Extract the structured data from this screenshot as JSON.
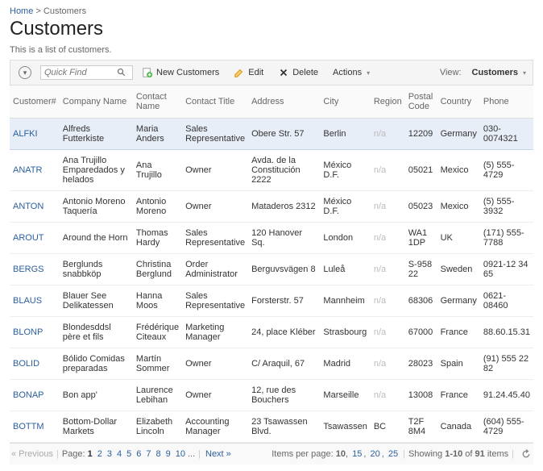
{
  "breadcrumb": {
    "home": "Home",
    "sep": ">",
    "current": "Customers"
  },
  "page_title": "Customers",
  "subtitle": "This is a list of customers.",
  "toolbar": {
    "quickfind_placeholder": "Quick Find",
    "new_label": "New Customers",
    "edit_label": "Edit",
    "delete_label": "Delete",
    "actions_label": "Actions",
    "view_label": "View:",
    "view_value": "Customers"
  },
  "columns": {
    "id": "Customer#",
    "company": "Company Name",
    "contact_name": "Contact Name",
    "contact_title": "Contact Title",
    "address": "Address",
    "city": "City",
    "region": "Region",
    "postal": "Postal Code",
    "country": "Country",
    "phone": "Phone"
  },
  "rows": [
    {
      "id": "ALFKI",
      "company": "Alfreds Futterkiste",
      "contact_name": "Maria Anders",
      "contact_title": "Sales Representative",
      "address": "Obere Str. 57",
      "city": "Berlin",
      "region": "n/a",
      "postal": "12209",
      "country": "Germany",
      "phone": "030-0074321",
      "selected": true
    },
    {
      "id": "ANATR",
      "company": "Ana Trujillo Emparedados y helados",
      "contact_name": "Ana Trujillo",
      "contact_title": "Owner",
      "address": "Avda. de la Constitución 2222",
      "city": "México D.F.",
      "region": "n/a",
      "postal": "05021",
      "country": "Mexico",
      "phone": "(5) 555-4729"
    },
    {
      "id": "ANTON",
      "company": "Antonio Moreno Taquería",
      "contact_name": "Antonio Moreno",
      "contact_title": "Owner",
      "address": "Mataderos 2312",
      "city": "México D.F.",
      "region": "n/a",
      "postal": "05023",
      "country": "Mexico",
      "phone": "(5) 555-3932"
    },
    {
      "id": "AROUT",
      "company": "Around the Horn",
      "contact_name": "Thomas Hardy",
      "contact_title": "Sales Representative",
      "address": "120 Hanover Sq.",
      "city": "London",
      "region": "n/a",
      "postal": "WA1 1DP",
      "country": "UK",
      "phone": "(171) 555-7788"
    },
    {
      "id": "BERGS",
      "company": "Berglunds snabbköp",
      "contact_name": "Christina Berglund",
      "contact_title": "Order Administrator",
      "address": "Berguvsvägen 8",
      "city": "Luleå",
      "region": "n/a",
      "postal": "S-958 22",
      "country": "Sweden",
      "phone": "0921-12 34 65"
    },
    {
      "id": "BLAUS",
      "company": "Blauer See Delikatessen",
      "contact_name": "Hanna Moos",
      "contact_title": "Sales Representative",
      "address": "Forsterstr. 57",
      "city": "Mannheim",
      "region": "n/a",
      "postal": "68306",
      "country": "Germany",
      "phone": "0621-08460"
    },
    {
      "id": "BLONP",
      "company": "Blondesddsl père et fils",
      "contact_name": "Frédérique Citeaux",
      "contact_title": "Marketing Manager",
      "address": "24, place Kléber",
      "city": "Strasbourg",
      "region": "n/a",
      "postal": "67000",
      "country": "France",
      "phone": "88.60.15.31"
    },
    {
      "id": "BOLID",
      "company": "Bólido Comidas preparadas",
      "contact_name": "Martín Sommer",
      "contact_title": "Owner",
      "address": "C/ Araquil, 67",
      "city": "Madrid",
      "region": "n/a",
      "postal": "28023",
      "country": "Spain",
      "phone": "(91) 555 22 82"
    },
    {
      "id": "BONAP",
      "company": "Bon app'",
      "contact_name": "Laurence Lebihan",
      "contact_title": "Owner",
      "address": "12, rue des Bouchers",
      "city": "Marseille",
      "region": "n/a",
      "postal": "13008",
      "country": "France",
      "phone": "91.24.45.40"
    },
    {
      "id": "BOTTM",
      "company": "Bottom-Dollar Markets",
      "contact_name": "Elizabeth Lincoln",
      "contact_title": "Accounting Manager",
      "address": "23 Tsawassen Blvd.",
      "city": "Tsawassen",
      "region": "BC",
      "postal": "T2F 8M4",
      "country": "Canada",
      "phone": "(604) 555-4729"
    }
  ],
  "pager": {
    "previous": "« Previous",
    "page_label": "Page:",
    "pages": [
      "1",
      "2",
      "3",
      "4",
      "5",
      "6",
      "7",
      "8",
      "9",
      "10"
    ],
    "more": "...",
    "next": "Next »",
    "ipp_label": "Items per page:",
    "ipp_options": [
      "10",
      "15",
      "20",
      "25"
    ],
    "ipp_current": "10",
    "showing_prefix": "Showing ",
    "showing_range": "1-10",
    "showing_of": " of ",
    "showing_total": "91",
    "showing_suffix": " items"
  }
}
